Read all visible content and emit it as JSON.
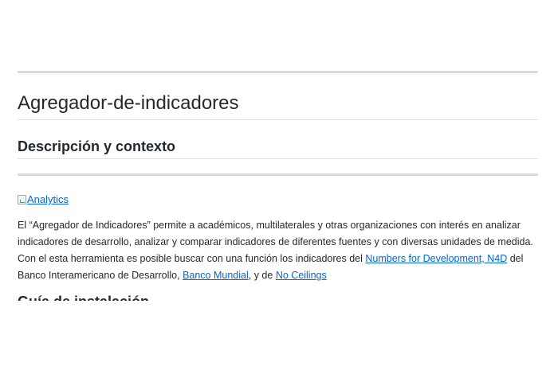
{
  "page": {
    "title": "Agregador-de-indicadores",
    "section_heading": "Descripción y contexto",
    "image": {
      "alt": "Analytics",
      "icon": "broken-image-icon"
    },
    "paragraph": {
      "text_1": "El “Agregador de Indicadores” permite a académicos, multilaterales y otras organizaciones con interés en analizar indicadores de desarrollo, analizar y comparar indicadores de diferentes fuentes y con diversas unidades de medida. Con el esta herramienta es posible buscar con una función los indicadores del ",
      "link_n4d": "Numbers for Development, N4D",
      "text_2": " del Banco Interamericano de Desarrollo, ",
      "link_banco_mundial": "Banco Mundial",
      "text_3": ", y de ",
      "link_no_ceilings": "No Ceilings"
    },
    "next_heading_partial": "Guía de instalación"
  },
  "colors": {
    "link": "#0366d6",
    "text": "#24292e",
    "rule": "#d5dbe0"
  }
}
